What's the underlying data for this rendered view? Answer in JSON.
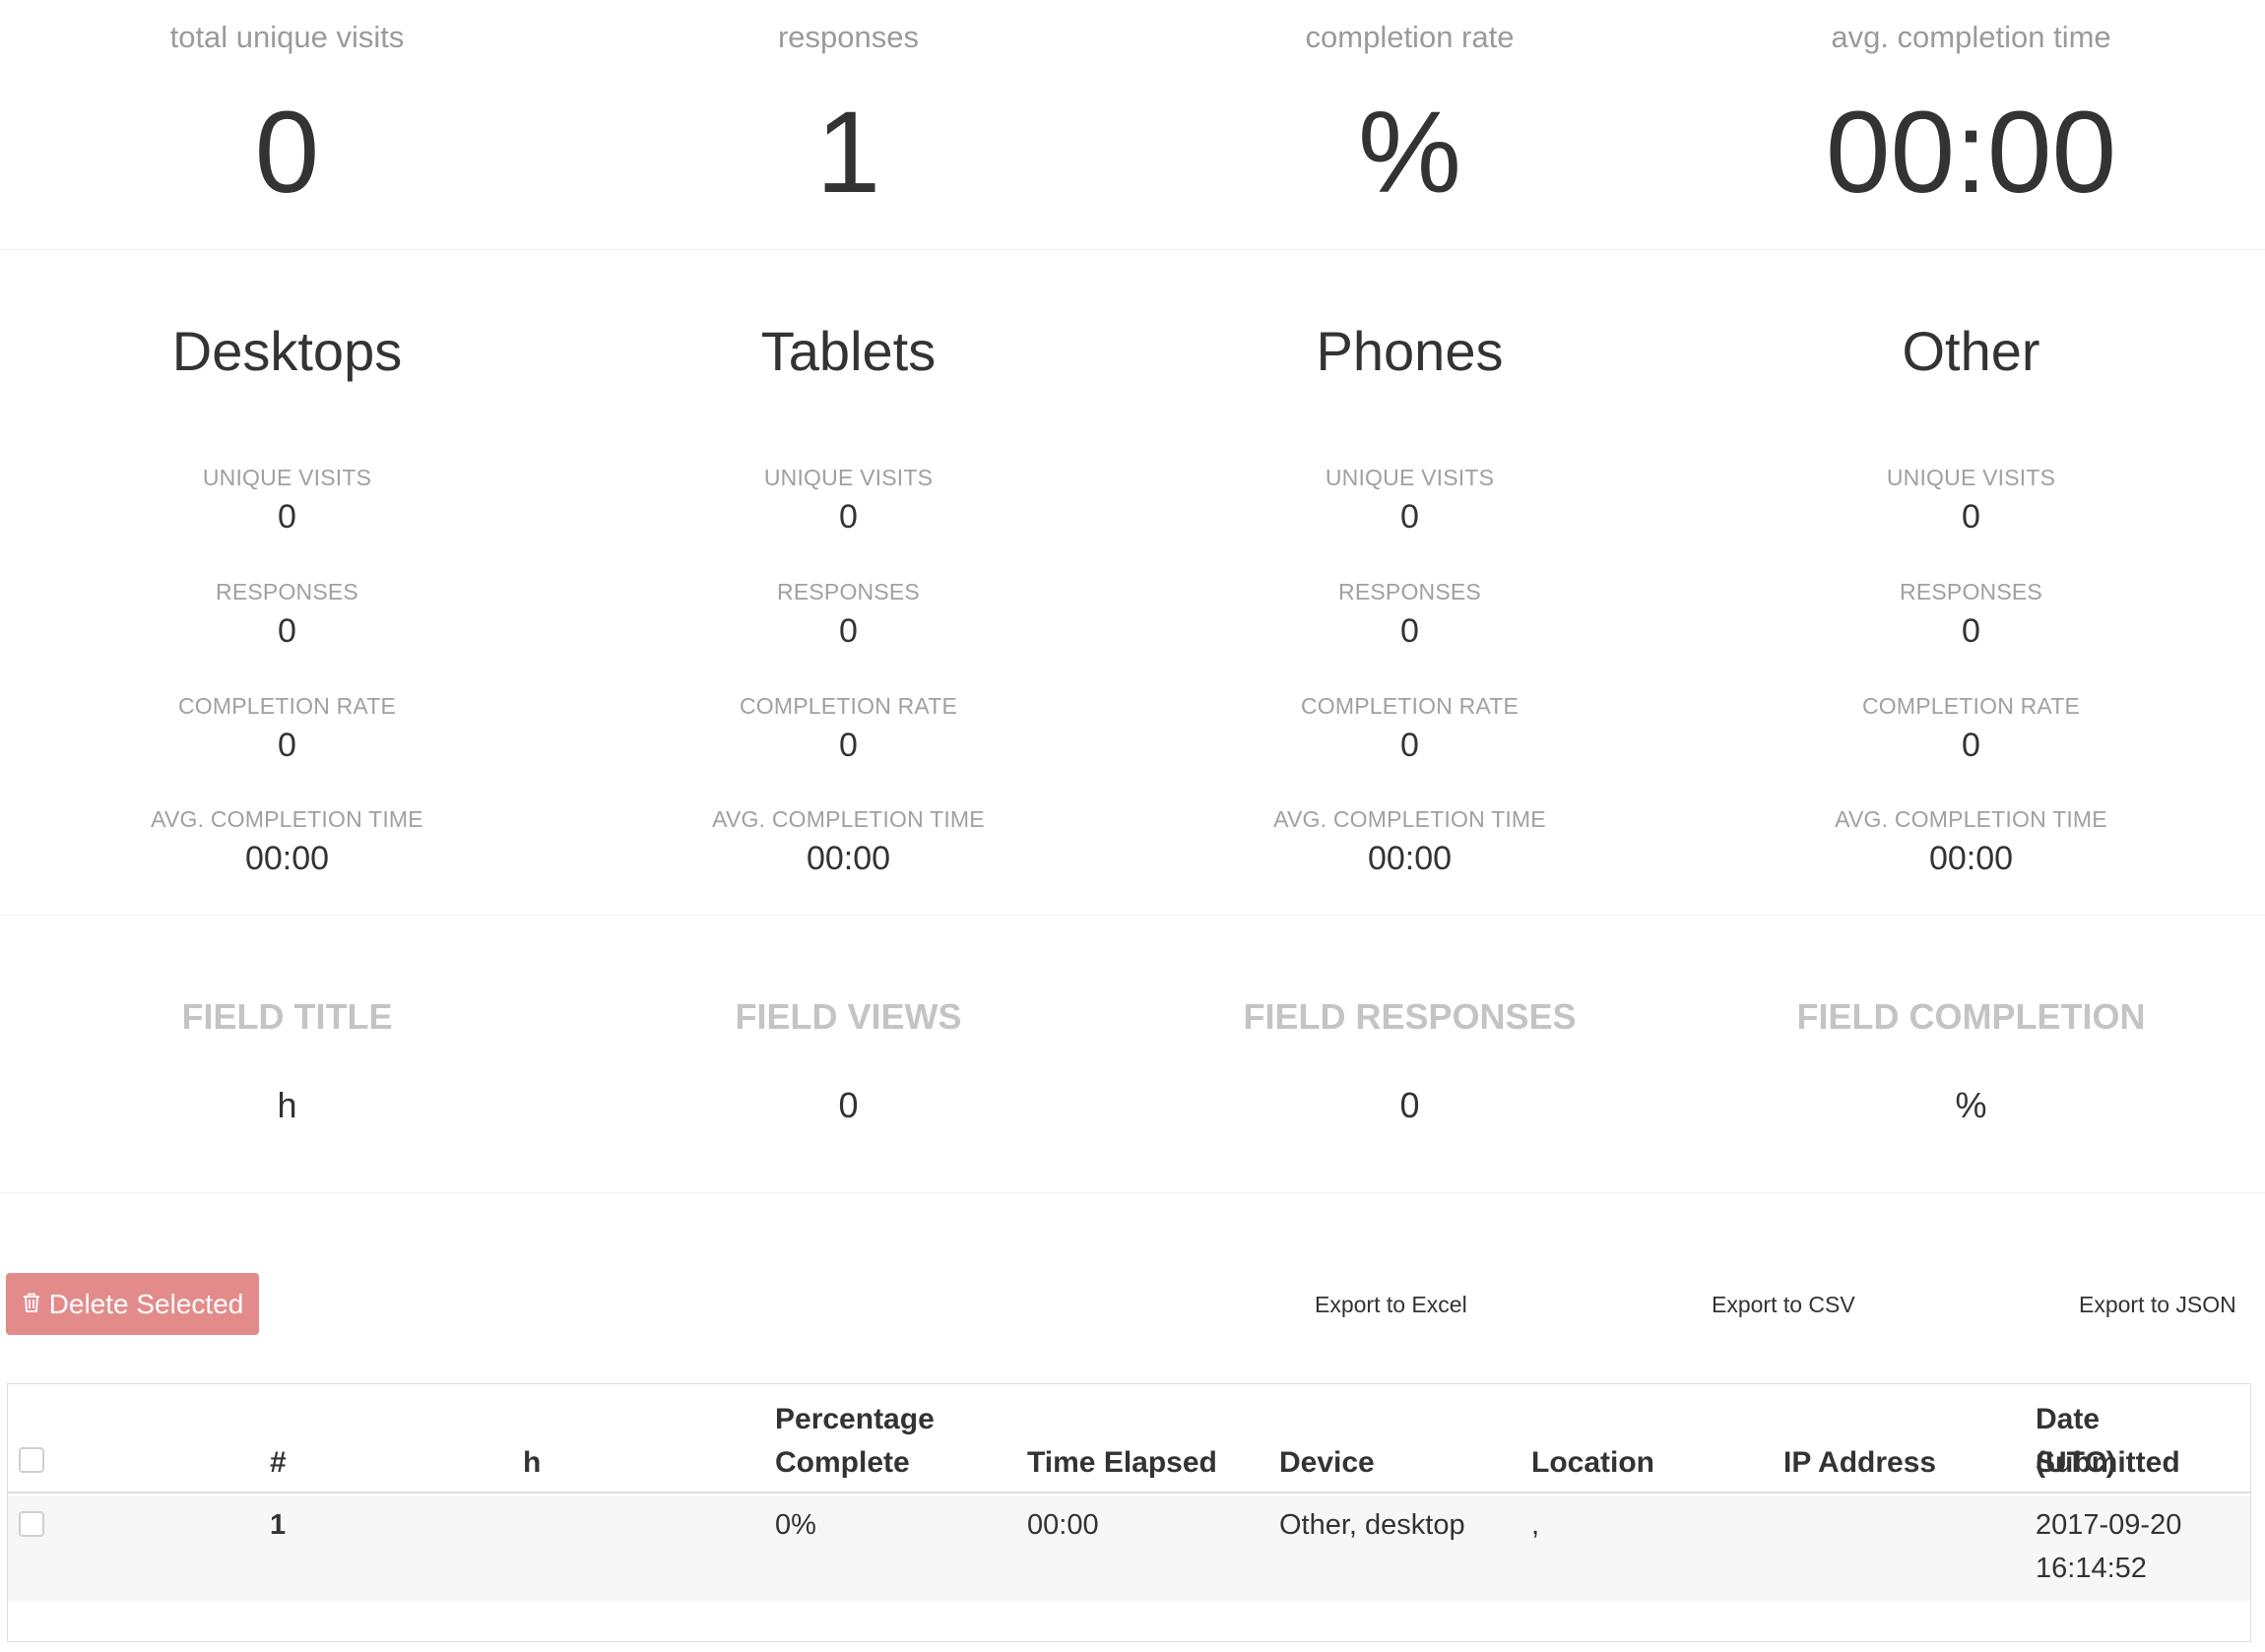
{
  "summary": [
    {
      "label": "total unique visits",
      "value": "0"
    },
    {
      "label": "responses",
      "value": "1"
    },
    {
      "label": "completion rate",
      "value": "%"
    },
    {
      "label": "avg. completion time",
      "value": "00:00"
    }
  ],
  "devices": [
    {
      "title": "Desktops",
      "unique_visits_label": "UNIQUE VISITS",
      "unique_visits": "0",
      "responses_label": "RESPONSES",
      "responses": "0",
      "completion_rate_label": "COMPLETION RATE",
      "completion_rate": "0",
      "avg_time_label": "AVG. COMPLETION TIME",
      "avg_time": "00:00"
    },
    {
      "title": "Tablets",
      "unique_visits_label": "UNIQUE VISITS",
      "unique_visits": "0",
      "responses_label": "RESPONSES",
      "responses": "0",
      "completion_rate_label": "COMPLETION RATE",
      "completion_rate": "0",
      "avg_time_label": "AVG. COMPLETION TIME",
      "avg_time": "00:00"
    },
    {
      "title": "Phones",
      "unique_visits_label": "UNIQUE VISITS",
      "unique_visits": "0",
      "responses_label": "RESPONSES",
      "responses": "0",
      "completion_rate_label": "COMPLETION RATE",
      "completion_rate": "0",
      "avg_time_label": "AVG. COMPLETION TIME",
      "avg_time": "00:00"
    },
    {
      "title": "Other",
      "unique_visits_label": "UNIQUE VISITS",
      "unique_visits": "0",
      "responses_label": "RESPONSES",
      "responses": "0",
      "completion_rate_label": "COMPLETION RATE",
      "completion_rate": "0",
      "avg_time_label": "AVG. COMPLETION TIME",
      "avg_time": "00:00"
    }
  ],
  "fields": {
    "headers": [
      "FIELD TITLE",
      "FIELD VIEWS",
      "FIELD RESPONSES",
      "FIELD COMPLETION"
    ],
    "values": [
      "h",
      "0",
      "0",
      "%"
    ]
  },
  "actions": {
    "delete_label": "Delete Selected",
    "delete_icon": "trash-icon",
    "delete_color": "#e38b8b",
    "export_excel": "Export to Excel",
    "export_csv": "Export to CSV",
    "export_json": "Export to JSON"
  },
  "table": {
    "columns": [
      {
        "key": "num",
        "label_1": "",
        "label_2": "#"
      },
      {
        "key": "h",
        "label_1": "",
        "label_2": "h"
      },
      {
        "key": "percent",
        "label_1": "Percentage",
        "label_2": "Complete"
      },
      {
        "key": "time",
        "label_1": "",
        "label_2": "Time Elapsed"
      },
      {
        "key": "device",
        "label_1": "",
        "label_2": "Device"
      },
      {
        "key": "location",
        "label_1": "",
        "label_2": "Location"
      },
      {
        "key": "ip",
        "label_1": "",
        "label_2": "IP Address"
      },
      {
        "key": "date",
        "label_1": "Date Submitted",
        "label_2": "(UTC)"
      }
    ],
    "rows": [
      {
        "num": "1",
        "h": "",
        "percent": "0%",
        "time": "00:00",
        "device": "Other, desktop",
        "location": ",",
        "ip": "",
        "date_1": "2017-09-20",
        "date_2": "16:14:52"
      }
    ]
  }
}
